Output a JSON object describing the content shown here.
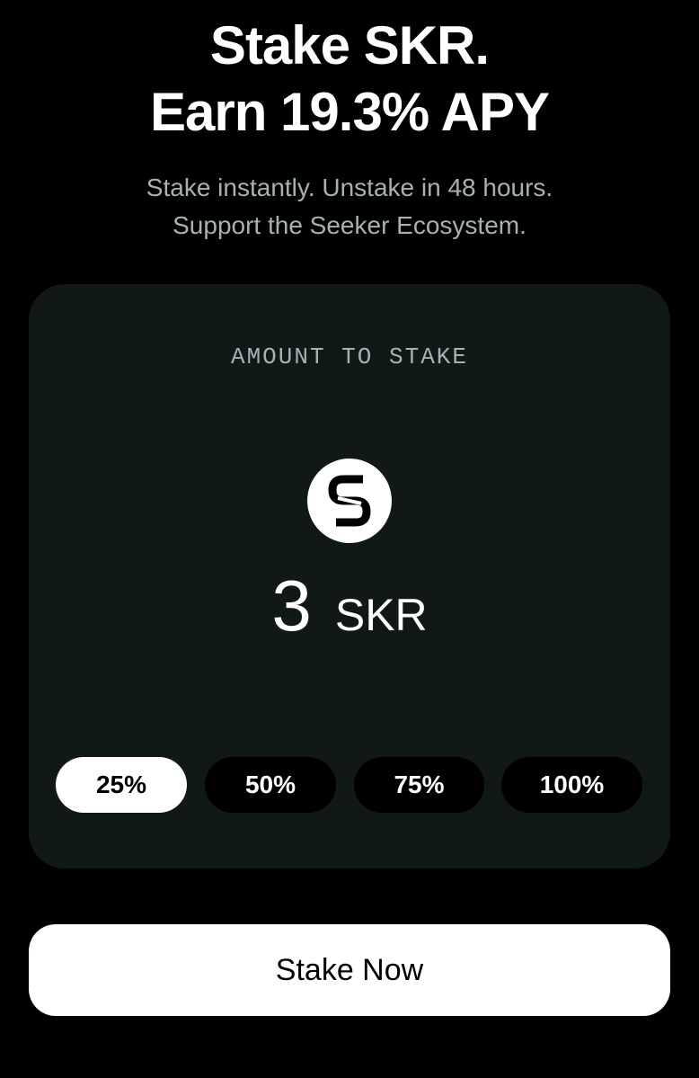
{
  "header": {
    "title_line1": "Stake SKR.",
    "title_line2": "Earn 19.3% APY",
    "subtitle_line1": "Stake instantly. Unstake in 48 hours.",
    "subtitle_line2": "Support the Seeker Ecosystem."
  },
  "stake_card": {
    "label": "AMOUNT TO STAKE",
    "token_icon": "skr-token-icon",
    "amount_value": "3",
    "amount_unit": "SKR",
    "percent_options": [
      {
        "label": "25%",
        "selected": true
      },
      {
        "label": "50%",
        "selected": false
      },
      {
        "label": "75%",
        "selected": false
      },
      {
        "label": "100%",
        "selected": false
      }
    ]
  },
  "actions": {
    "stake_button_label": "Stake Now"
  },
  "colors": {
    "background": "#000000",
    "card": "#111818",
    "muted_text": "#a7b1b1",
    "primary": "#ffffff"
  }
}
